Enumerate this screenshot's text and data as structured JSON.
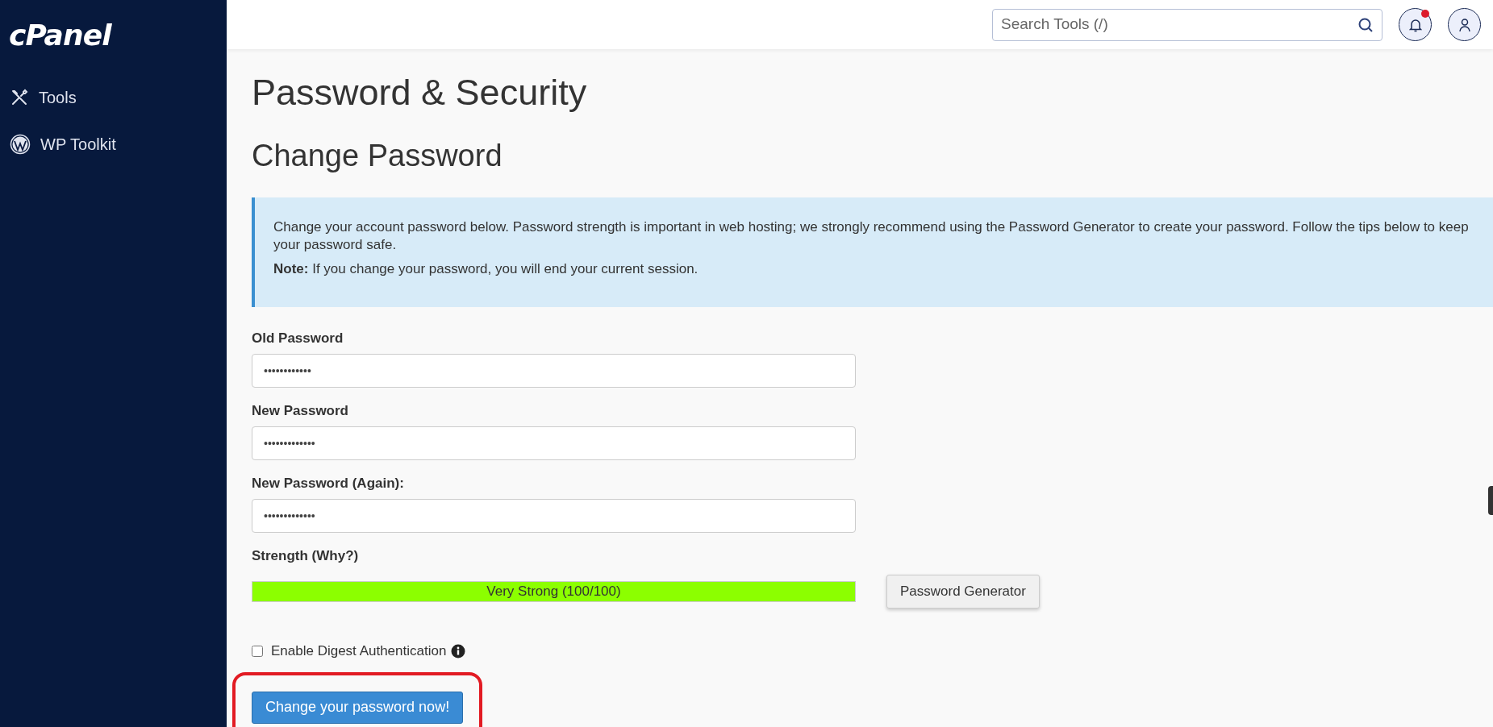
{
  "sidebar": {
    "logo": "cPanel",
    "items": [
      {
        "label": "Tools",
        "kind": "tools",
        "selected": false
      },
      {
        "label": "WP Toolkit",
        "kind": "wordpress",
        "selected": false
      }
    ]
  },
  "header": {
    "search": {
      "placeholder": "Search Tools (/)"
    },
    "notifications": {
      "unread": true
    }
  },
  "page_title": "Password & Security",
  "section_title": "Change Password",
  "info": {
    "text": "Change your account password below. Password strength is important in web hosting; we strongly recommend using the Password Generator to create your password. Follow the tips below to keep your password safe.",
    "note": "**Note:** If you change your password, you will end your current session."
  },
  "fields": [
    {
      "label": "Old Password",
      "value": "••••••••••••"
    },
    {
      "label": "New Password",
      "value": "•••••••••••••"
    },
    {
      "label": "New Password (Again):",
      "value": "•••••••••••••"
    }
  ],
  "strength": {
    "label": "Strength (Why?)",
    "level": 1.0,
    "reading": "Very Strong (100/100)"
  },
  "generator_button": "Password Generator",
  "digest": {
    "label": "Enable Digest Authentication",
    "checked": false
  },
  "submit_button": {
    "label": "Change your password now!",
    "highlighted": true
  }
}
